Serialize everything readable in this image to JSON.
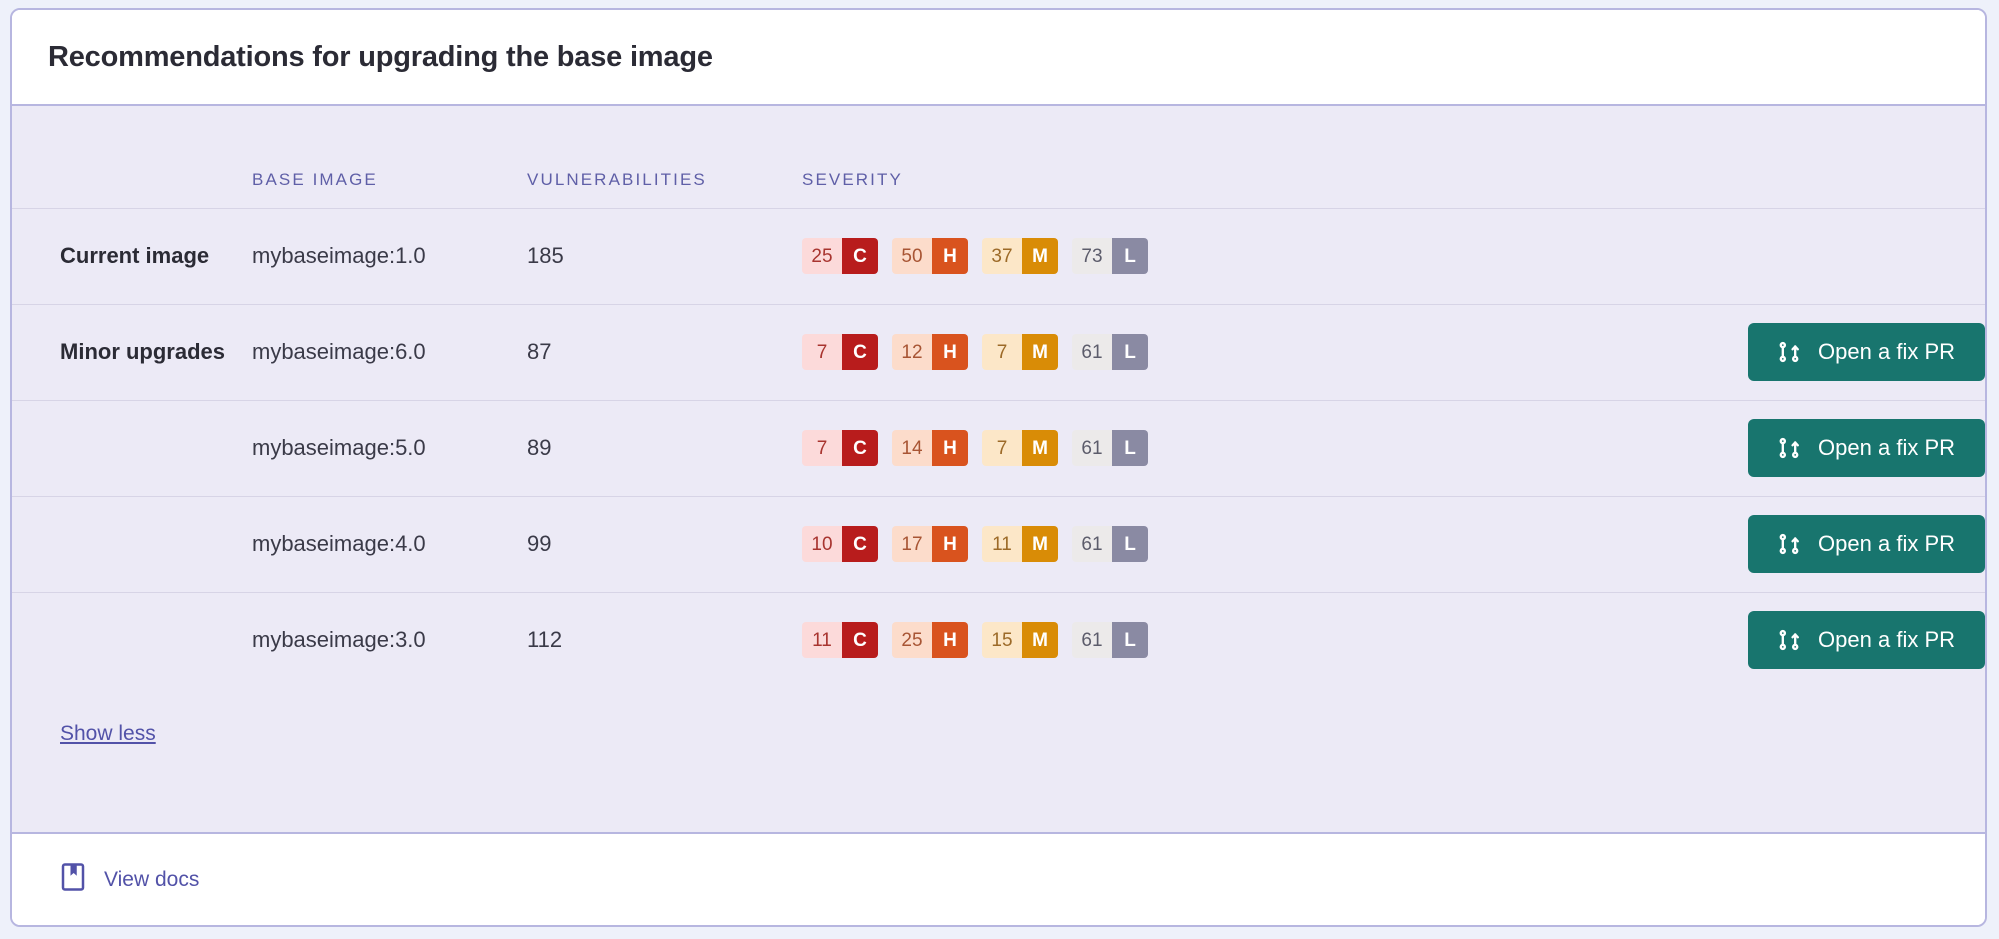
{
  "card": {
    "title": "Recommendations for upgrading the base image",
    "show_less_label": "Show less",
    "footer": {
      "docs_label": "View docs",
      "docs_icon": "book-icon"
    }
  },
  "table": {
    "headers": {
      "label": "",
      "base_image": "BASE IMAGE",
      "vulnerabilities": "VULNERABILITIES",
      "severity": "SEVERITY",
      "action": ""
    },
    "rows": [
      {
        "label": "Current image",
        "base_image": "mybaseimage:1.0",
        "vulnerabilities": "185",
        "severity": {
          "critical": "25",
          "high": "50",
          "medium": "37",
          "low": "73"
        },
        "action_label": ""
      },
      {
        "label": "Minor upgrades",
        "base_image": "mybaseimage:6.0",
        "vulnerabilities": "87",
        "severity": {
          "critical": "7",
          "high": "12",
          "medium": "7",
          "low": "61"
        },
        "action_label": "Open a fix PR"
      },
      {
        "label": "",
        "base_image": "mybaseimage:5.0",
        "vulnerabilities": "89",
        "severity": {
          "critical": "7",
          "high": "14",
          "medium": "7",
          "low": "61"
        },
        "action_label": "Open a fix PR"
      },
      {
        "label": "",
        "base_image": "mybaseimage:4.0",
        "vulnerabilities": "99",
        "severity": {
          "critical": "10",
          "high": "17",
          "medium": "11",
          "low": "61"
        },
        "action_label": "Open a fix PR"
      },
      {
        "label": "",
        "base_image": "mybaseimage:3.0",
        "vulnerabilities": "112",
        "severity": {
          "critical": "11",
          "high": "25",
          "medium": "15",
          "low": "61"
        },
        "action_label": "Open a fix PR"
      }
    ]
  },
  "severity_letters": {
    "critical": "C",
    "high": "H",
    "medium": "M",
    "low": "L"
  },
  "colors": {
    "critical": "#b81c1c",
    "high": "#d9531e",
    "medium": "#d98c06",
    "low": "#8a8aa3",
    "button": "#18756e",
    "link": "#5252a8",
    "card_border": "#b7b6e0",
    "body_background": "#eceaf6",
    "header_text": "#5f5fa7"
  },
  "icons": {
    "pull_request": "pull-request-icon"
  }
}
